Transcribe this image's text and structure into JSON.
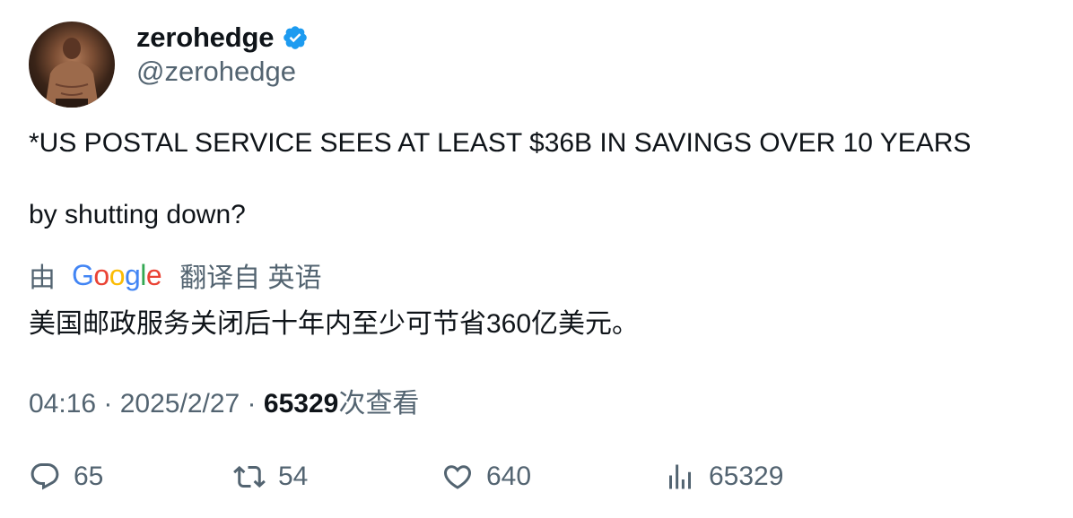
{
  "author": {
    "display_name": "zerohedge",
    "handle": "@zerohedge",
    "verified": true,
    "verified_color": "#1d9bf0",
    "avatar_icon": "profile-photo"
  },
  "tweet": {
    "line1": "*US POSTAL SERVICE SEES AT LEAST $36B IN SAVINGS OVER 10 YEARS",
    "line2": "by shutting down?"
  },
  "translation": {
    "prefix": "由",
    "provider": "Google",
    "suffix": "翻译自 英语",
    "text": "美国邮政服务关闭后十年内至少可节省360亿美元。"
  },
  "meta": {
    "time": "04:16",
    "date": "2025/2/27",
    "separator": " · ",
    "views": "65329",
    "views_label": "次查看"
  },
  "actions": {
    "replies": "65",
    "retweets": "54",
    "likes": "640",
    "views": "65329"
  },
  "colors": {
    "text": "#0f1419",
    "secondary": "#536471",
    "google_blue": "#4285f4",
    "google_red": "#ea4335",
    "google_yellow": "#fbbc05",
    "google_green": "#34a853"
  }
}
